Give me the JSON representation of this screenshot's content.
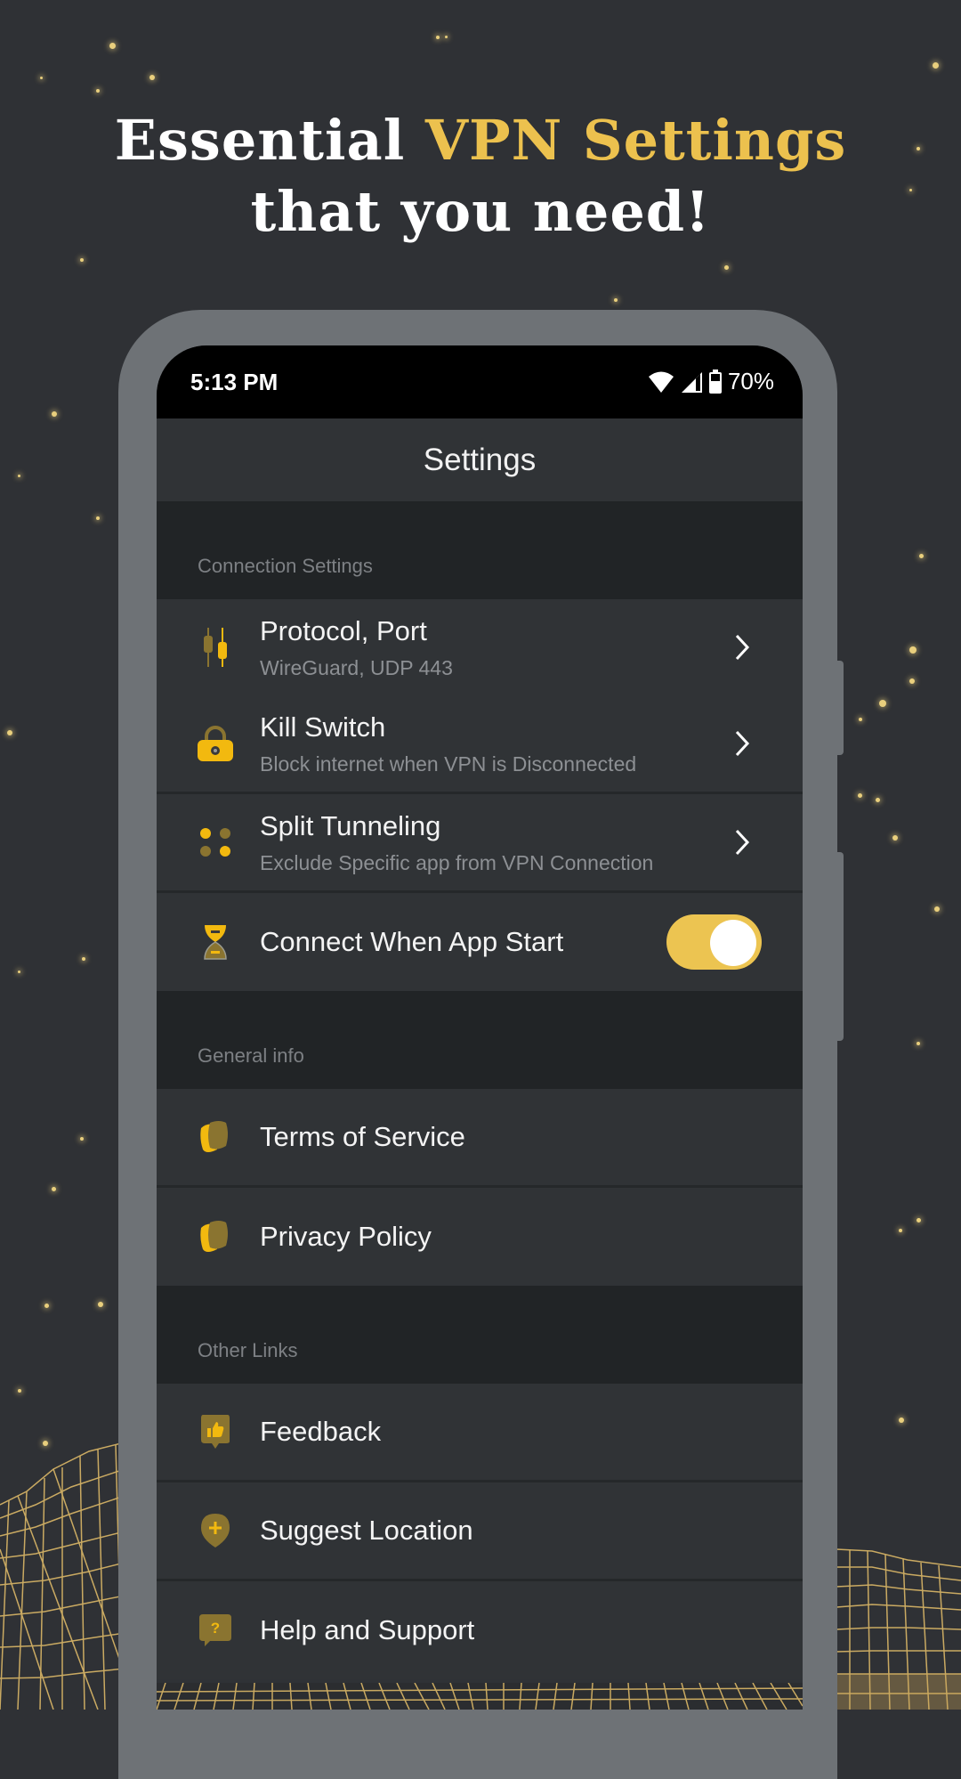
{
  "headline": {
    "line1_prefix": "Essential ",
    "line1_accent": "VPN Settings",
    "line2": "that you need!"
  },
  "colors": {
    "accent": "#ecc14e",
    "background": "#2f3135",
    "toggle_on": "#ecc451"
  },
  "status_bar": {
    "time": "5:13 PM",
    "battery": "70%",
    "icons": [
      "wifi-icon",
      "signal-icon",
      "battery-icon"
    ]
  },
  "screen": {
    "title": "Settings",
    "sections": [
      {
        "header": "Connection Settings",
        "items": [
          {
            "icon": "sliders-icon",
            "title": "Protocol, Port",
            "subtitle": "WireGuard, UDP 443",
            "control": "chevron"
          },
          {
            "icon": "lock-icon",
            "title": "Kill Switch",
            "subtitle": "Block internet when VPN is Disconnected",
            "control": "chevron"
          },
          {
            "icon": "split-dots-icon",
            "title": "Split Tunneling",
            "subtitle": "Exclude Specific app from VPN Connection",
            "control": "chevron"
          },
          {
            "icon": "hourglass-icon",
            "title": "Connect When App Start",
            "control": "toggle",
            "toggle_on": true
          }
        ]
      },
      {
        "header": "General info",
        "items": [
          {
            "icon": "document-icon",
            "title": "Terms of Service"
          },
          {
            "icon": "document-icon",
            "title": "Privacy Policy"
          }
        ]
      },
      {
        "header": "Other Links",
        "items": [
          {
            "icon": "thumbs-up-icon",
            "title": "Feedback"
          },
          {
            "icon": "location-pin-plus-icon",
            "title": "Suggest Location"
          },
          {
            "icon": "help-bubble-icon",
            "title": "Help and Support"
          }
        ]
      }
    ]
  }
}
